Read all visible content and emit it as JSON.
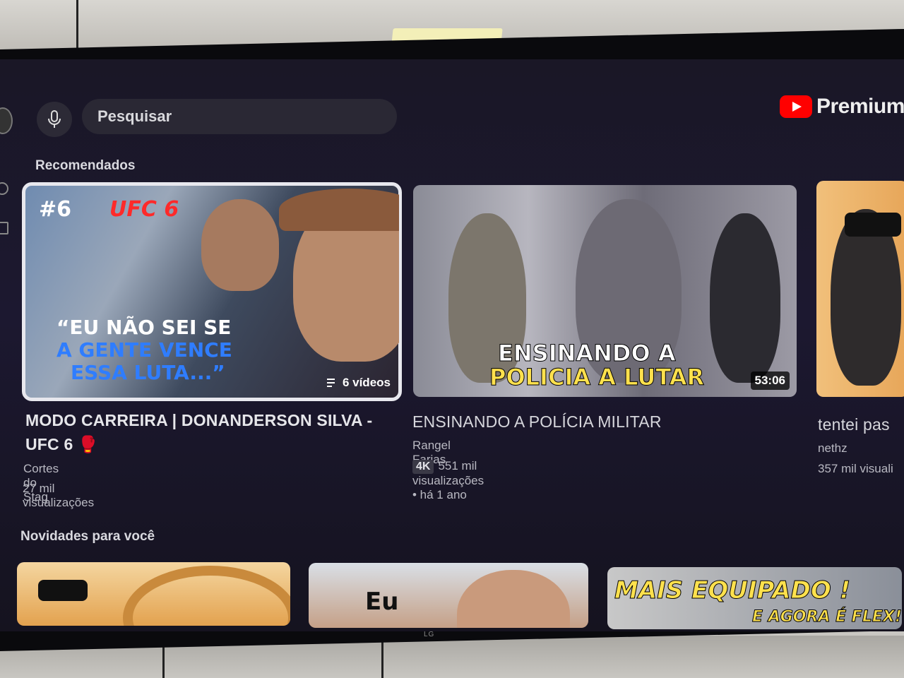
{
  "search": {
    "placeholder": "Pesquisar"
  },
  "brand": {
    "name": "Premium",
    "logo_icon": "youtube-logo-icon"
  },
  "sections": [
    {
      "title": "Recomendados"
    },
    {
      "title": "Novidades para você"
    }
  ],
  "recommended": [
    {
      "title": "MODO CARREIRA | DONANDERSON SILVA - UFC 6 🥊",
      "channel": "Cortes do Stag",
      "views": "27 mil visualizações",
      "playlist_label": "6 vídeos",
      "thumb_text": {
        "tag": "#6",
        "game": "UFC 6",
        "quote_1": "“EU NÃO SEI SE",
        "quote_2": "A GENTE VENCE",
        "quote_3": "ESSA LUTA...”"
      }
    },
    {
      "title": "ENSINANDO A POLÍCIA MILITAR",
      "channel": "Rangel Farias",
      "badge": "4K",
      "views": "551 mil visualizações • há 1 ano",
      "duration": "53:06",
      "thumb_text": {
        "line_1": "ENSINANDO A",
        "line_2": "POLICIA A LUTAR"
      }
    },
    {
      "title": "tentei pas",
      "channel": "nethz",
      "views": "357 mil visuali"
    }
  ],
  "news": [
    {
      "thumb_text": ""
    },
    {
      "thumb_text": "Eu"
    },
    {
      "thumb_text_1": "MAIS EQUIPADO !",
      "thumb_text_2": "E AGORA É FLEX!"
    }
  ],
  "tv_brand": "LG",
  "colors": {
    "youtube_red": "#ff0000",
    "background": "#1a1726",
    "focus_outline": "#e8e8ee",
    "headline_blue": "#2f7dff",
    "headline_yellow": "#ffe14d"
  }
}
